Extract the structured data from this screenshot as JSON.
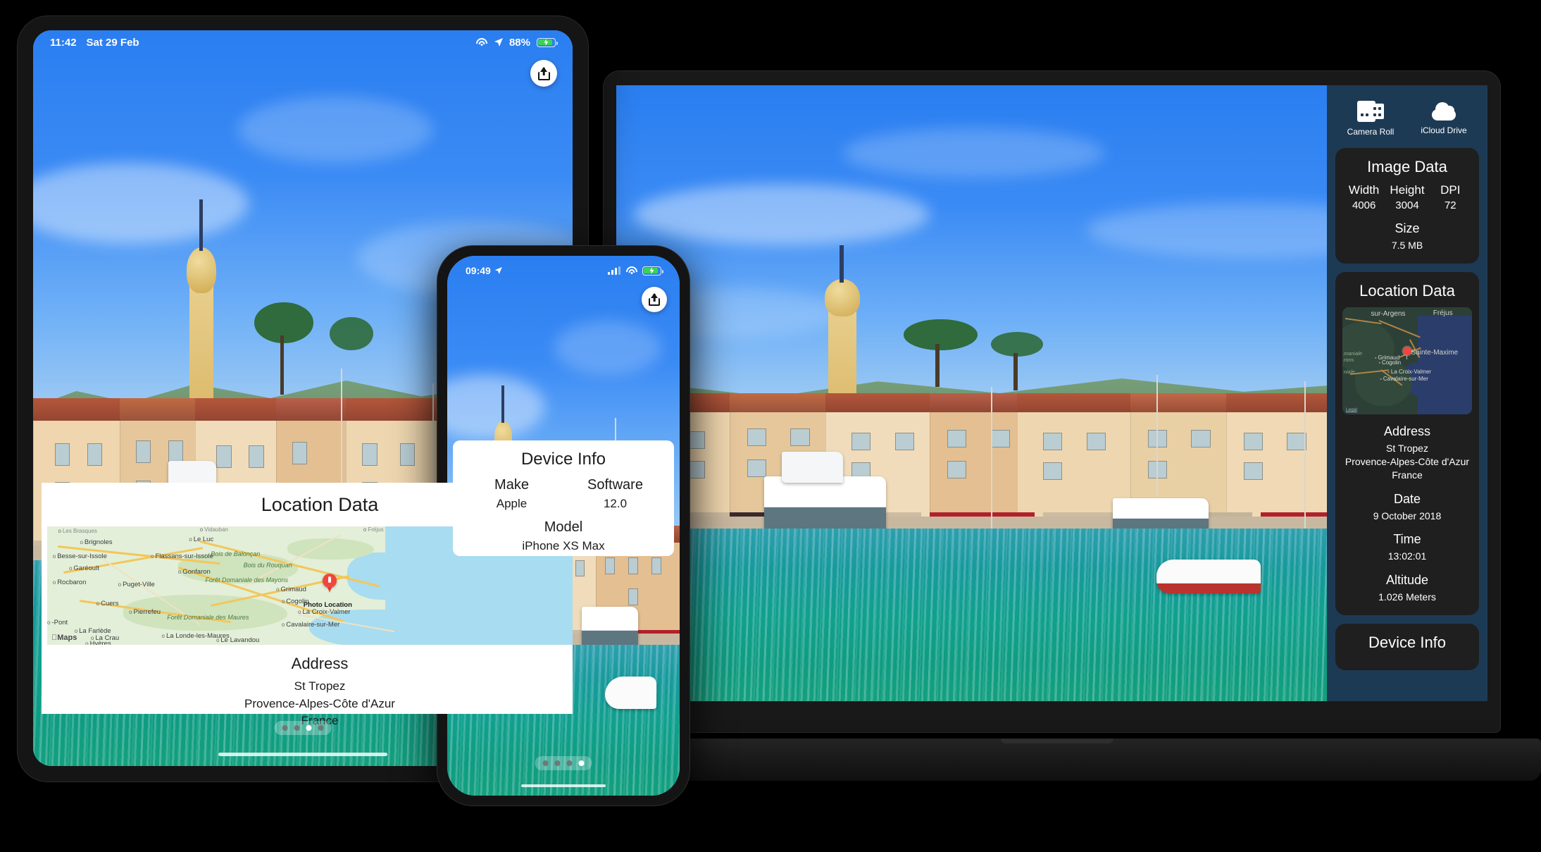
{
  "ipad": {
    "status": {
      "time": "11:42",
      "date": "Sat 29 Feb",
      "battery_percent": "88%"
    },
    "share_label": "share-icon",
    "card": {
      "title": "Location Data",
      "address_label": "Address",
      "address_lines": [
        "St Tropez",
        "Provence-Alpes-Côte d'Azur",
        "France"
      ]
    },
    "map": {
      "pin_label": "Photo Location",
      "attribution": "Maps",
      "towns": [
        "Brignoles",
        "Le Luc",
        "Besse-sur-Issole",
        "Flassans-sur-Issole",
        "Garéoult",
        "Gonfaron",
        "Rocbaron",
        "Puget-Ville",
        "Grimaud",
        "Cogolin",
        "Cuers",
        "Pierrefeu",
        "La Croix-Valmer",
        "Cavalaire-sur-Mer",
        "-Pont",
        "La Farlède",
        "La Crau",
        "La Londe-les-Maures",
        "Le Lavandou",
        "Hyères",
        "Les Brasques",
        "Vidauban",
        "Fréjus"
      ],
      "parks": [
        "Bois de Balonçan",
        "Bois du Rouquan",
        "Forêt Domaniale des Mayons",
        "Forêt Domaniale des Maures"
      ]
    },
    "page_dots": {
      "count": 4,
      "active": 3
    }
  },
  "iphone": {
    "status": {
      "time": "09:49",
      "battery_percent": ""
    },
    "share_label": "share-icon",
    "card": {
      "title": "Device Info",
      "fields": [
        {
          "label": "Make",
          "value": "Apple"
        },
        {
          "label": "Software",
          "value": "12.0"
        }
      ],
      "model_label": "Model",
      "model_value": "iPhone XS Max"
    },
    "page_dots": {
      "count": 4,
      "active": 4
    }
  },
  "laptop": {
    "sidebar": {
      "sources": [
        {
          "label": "Camera Roll",
          "icon": "film-roll-icon"
        },
        {
          "label": "iCloud Drive",
          "icon": "cloud-icon"
        }
      ],
      "image_data": {
        "title": "Image Data",
        "width_label": "Width",
        "width_value": "4006",
        "height_label": "Height",
        "height_value": "3004",
        "dpi_label": "DPI",
        "dpi_value": "72",
        "size_label": "Size",
        "size_value": "7.5 MB"
      },
      "location_data": {
        "title": "Location Data",
        "address_label": "Address",
        "address_lines": [
          "St Tropez",
          "Provence-Alpes-Côte d'Azur",
          "France"
        ],
        "date_label": "Date",
        "date_value": "9 October 2018",
        "time_label": "Time",
        "time_value": "13:02:01",
        "altitude_label": "Altitude",
        "altitude_value": "1.026 Meters",
        "map": {
          "legal": "Legal",
          "towns": [
            "Grimaud",
            "Cogolin",
            "La Croix-Valmer",
            "Cavalaire-sur-Mer"
          ],
          "big_labels": [
            "sur-Argens",
            "Fréjus",
            "Sainte-Maxime"
          ],
          "parks": [
            "maniale",
            "rons",
            "niale"
          ]
        }
      },
      "device_info": {
        "title": "Device Info"
      }
    }
  },
  "colors": {
    "sidebar_bg": "#1d3a55",
    "panel_bg": "#1f1f1f",
    "accent_pin": "#f0473c",
    "battery_green": "#3ad35a",
    "sky_blue": "#3b8bf5",
    "sea_teal": "#10a08d"
  }
}
